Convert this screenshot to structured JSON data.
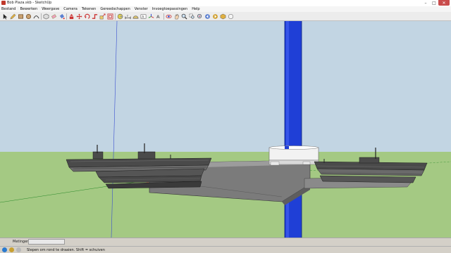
{
  "window": {
    "title": "Bob Plaza.skb - SketchUp",
    "controls": [
      "minimize-icon",
      "maximize-icon",
      "close-icon"
    ]
  },
  "menu": {
    "items": [
      "Bestand",
      "Bewerken",
      "Weergave",
      "Camera",
      "Tekenen",
      "Gereedschappen",
      "Venster",
      "Invoegtoepassingen",
      "Help"
    ]
  },
  "toolbar": {
    "tools": [
      "select-icon",
      "pencil-icon",
      "rectangle-icon",
      "circle-icon",
      "arc-icon",
      "make-component-icon",
      "eraser-icon",
      "paint-bucket-icon",
      "push-pull-icon",
      "move-icon",
      "rotate-icon",
      "follow-me-icon",
      "scale-icon",
      "offset-icon",
      "tape-measure-icon",
      "dimension-icon",
      "protractor-icon",
      "text-icon",
      "axes-icon",
      "3d-text-icon",
      "orbit-icon",
      "pan-icon",
      "zoom-icon",
      "zoom-window-icon",
      "zoom-extents-icon",
      "previous-view-icon",
      "next-view-icon",
      "get-models-icon",
      "share-model-icon",
      "components-icon",
      "extension-icon"
    ]
  },
  "measurements": {
    "label": "Metingen",
    "value": ""
  },
  "status": {
    "text": "Slepen om rond te draaien. Shift = schuiven"
  },
  "colors": {
    "sky": "#c2d5e3",
    "ground": "#a4c983",
    "blue_axis": "#1f3fd6",
    "platform_top": "#b8b8b8",
    "platform_side": "#7a7a7a",
    "ship_dark": "#3d3d3d"
  }
}
